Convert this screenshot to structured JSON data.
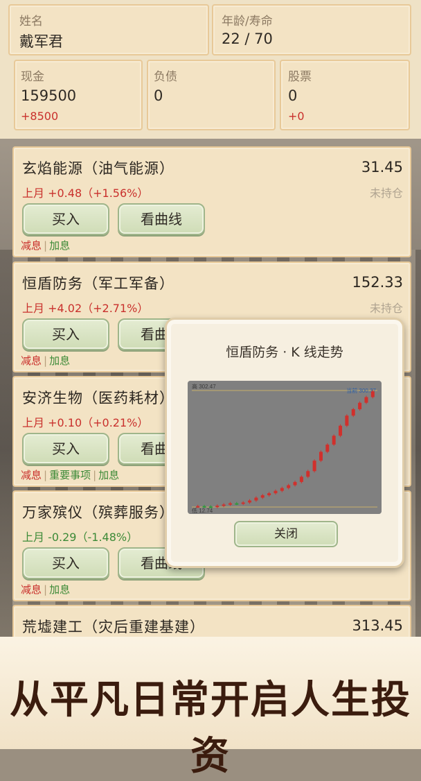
{
  "profile": {
    "name_label": "姓名",
    "name": "戴军君",
    "age_label": "年龄/寿命",
    "age": "22 / 70",
    "cash_label": "现金",
    "cash": "159500",
    "cash_delta": "+8500",
    "debt_label": "负债",
    "debt": "0",
    "stock_label": "股票",
    "stock": "0",
    "stock_delta": "+0"
  },
  "stocks": [
    {
      "name": "玄焰能源（油气能源）",
      "price": "31.45",
      "change": "上月 +0.48（+1.56%）",
      "change_dir": "up",
      "holding": "未持仓",
      "buy": "买入",
      "curve": "看曲线",
      "links": [
        "减息",
        "加息"
      ]
    },
    {
      "name": "恒盾防务（军工军备）",
      "price": "152.33",
      "change": "上月 +4.02（+2.71%）",
      "change_dir": "up",
      "holding": "未持仓",
      "buy": "买入",
      "curve": "看曲线",
      "links": [
        "减息",
        "加息"
      ]
    },
    {
      "name": "安济生物（医药耗材）",
      "price": "",
      "change": "上月 +0.10（+0.21%）",
      "change_dir": "up",
      "holding": "",
      "buy": "买入",
      "curve": "看曲线",
      "links": [
        "减息",
        "重要事项",
        "加息"
      ]
    },
    {
      "name": "万家殡仪（殡葬服务）",
      "price": "",
      "change": "上月 -0.29（-1.48%）",
      "change_dir": "down",
      "holding": "",
      "buy": "买入",
      "curve": "看曲线",
      "links": [
        "减息",
        "加息"
      ]
    },
    {
      "name": "荒墟建工（灾后重建基建）",
      "price": "313.45"
    }
  ],
  "modal": {
    "title": "恒盾防务 · K 线走势",
    "close": "关闭"
  },
  "chart_data": {
    "type": "candlestick",
    "high_label": "高 302.47",
    "current_label": "当前 300.37",
    "low_label": "低 12.74",
    "ylim": [
      12.74,
      302.47
    ],
    "candles": [
      {
        "o": 14,
        "c": 15,
        "dir": "up"
      },
      {
        "o": 15,
        "c": 14,
        "dir": "down"
      },
      {
        "o": 14,
        "c": 13,
        "dir": "down"
      },
      {
        "o": 13,
        "c": 16,
        "dir": "up"
      },
      {
        "o": 16,
        "c": 19,
        "dir": "up"
      },
      {
        "o": 19,
        "c": 22,
        "dir": "up"
      },
      {
        "o": 22,
        "c": 21,
        "dir": "down"
      },
      {
        "o": 21,
        "c": 24,
        "dir": "up"
      },
      {
        "o": 24,
        "c": 29,
        "dir": "up"
      },
      {
        "o": 29,
        "c": 36,
        "dir": "up"
      },
      {
        "o": 36,
        "c": 42,
        "dir": "up"
      },
      {
        "o": 42,
        "c": 47,
        "dir": "up"
      },
      {
        "o": 47,
        "c": 53,
        "dir": "up"
      },
      {
        "o": 53,
        "c": 60,
        "dir": "up"
      },
      {
        "o": 60,
        "c": 67,
        "dir": "up"
      },
      {
        "o": 67,
        "c": 75,
        "dir": "up"
      },
      {
        "o": 75,
        "c": 88,
        "dir": "up"
      },
      {
        "o": 88,
        "c": 102,
        "dir": "up"
      },
      {
        "o": 102,
        "c": 128,
        "dir": "up"
      },
      {
        "o": 128,
        "c": 150,
        "dir": "up"
      },
      {
        "o": 150,
        "c": 168,
        "dir": "up"
      },
      {
        "o": 168,
        "c": 190,
        "dir": "up"
      },
      {
        "o": 190,
        "c": 215,
        "dir": "up"
      },
      {
        "o": 215,
        "c": 240,
        "dir": "up"
      },
      {
        "o": 240,
        "c": 256,
        "dir": "up"
      },
      {
        "o": 256,
        "c": 272,
        "dir": "up"
      },
      {
        "o": 272,
        "c": 286,
        "dir": "up"
      },
      {
        "o": 286,
        "c": 300.37,
        "dir": "up"
      }
    ],
    "colors": {
      "up": "#d0302c",
      "down": "#2e9a3a",
      "ref": "#c7b06a"
    }
  },
  "banner": {
    "text": "从平凡日常开启人生投资"
  }
}
